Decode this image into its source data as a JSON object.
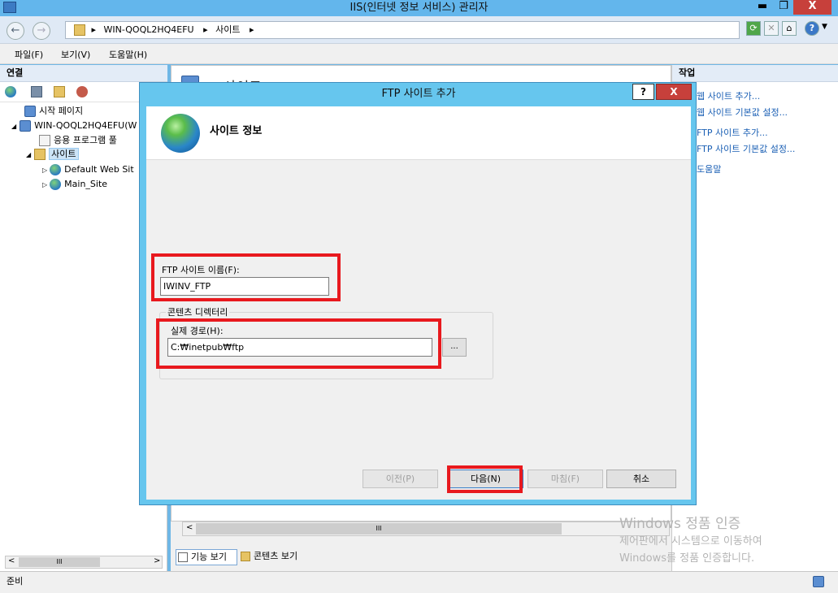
{
  "window": {
    "title": "IIS(인터넷 정보 서비스) 관리자",
    "minimize": "▬",
    "restore": "❐",
    "close": "X"
  },
  "address": {
    "back": "←",
    "forward": "→",
    "crumbs": [
      "WIN-QOQL2HQ4EFU",
      "사이트"
    ],
    "sep": "▸",
    "help": "?"
  },
  "menubar": {
    "file": "파일(F)",
    "view": "보기(V)",
    "help": "도움말(H)"
  },
  "connections": {
    "header": "연결",
    "tree": [
      {
        "label": "시작 페이지",
        "icon": "start-page-icon"
      },
      {
        "label": "WIN-QOQL2HQ4EFU(W",
        "icon": "server-icon",
        "toggle": "◢"
      },
      {
        "label": "응용 프로그램 풀",
        "icon": "app-pool-icon"
      },
      {
        "label": "사이트",
        "icon": "sites-folder-icon",
        "toggle": "◢"
      },
      {
        "label": "Default Web Sit",
        "icon": "globe-icon",
        "toggle": "▷"
      },
      {
        "label": "Main_Site",
        "icon": "globe-icon",
        "toggle": "▷"
      }
    ],
    "scroll_left": "<",
    "scroll_right": ">",
    "scroll_thumb": "III"
  },
  "center": {
    "heading_partial": "사이트",
    "scroll_left": "<",
    "scroll_thumb": "III",
    "tabs": {
      "features": "기능 보기",
      "content": "콘텐츠 보기"
    }
  },
  "actions": {
    "header": "작업",
    "items": [
      "웹 사이트 추가...",
      "웹 사이트 기본값 설정...",
      "FTP 사이트 추가...",
      "FTP 사이트 기본값 설정...",
      "도움말"
    ]
  },
  "status": {
    "text": "준비"
  },
  "watermark": {
    "line1": "Windows 정품 인증",
    "line2": "제어판에서 시스템으로 이동하여",
    "line3": "Windows를 정품 인증합니다."
  },
  "dialog": {
    "title": "FTP 사이트 추가",
    "help": "?",
    "close": "X",
    "heading": "사이트 정보",
    "site_name_label": "FTP 사이트 이름(F):",
    "site_name_value": "IWINV_FTP",
    "content_dir_label": "콘텐츠 디렉터리",
    "physical_path_label": "실제 경로(H):",
    "physical_path_value": "C:₩inetpub₩ftp",
    "browse": "...",
    "buttons": {
      "previous": "이전(P)",
      "next": "다음(N)",
      "finish": "마침(F)",
      "cancel": "취소"
    }
  },
  "colors": {
    "title_bar": "#63b6ec",
    "dialog_frame": "#66c6ee",
    "close_red": "#c7403b",
    "highlight_red": "#e8191e",
    "link_blue": "#1a5fb4"
  }
}
